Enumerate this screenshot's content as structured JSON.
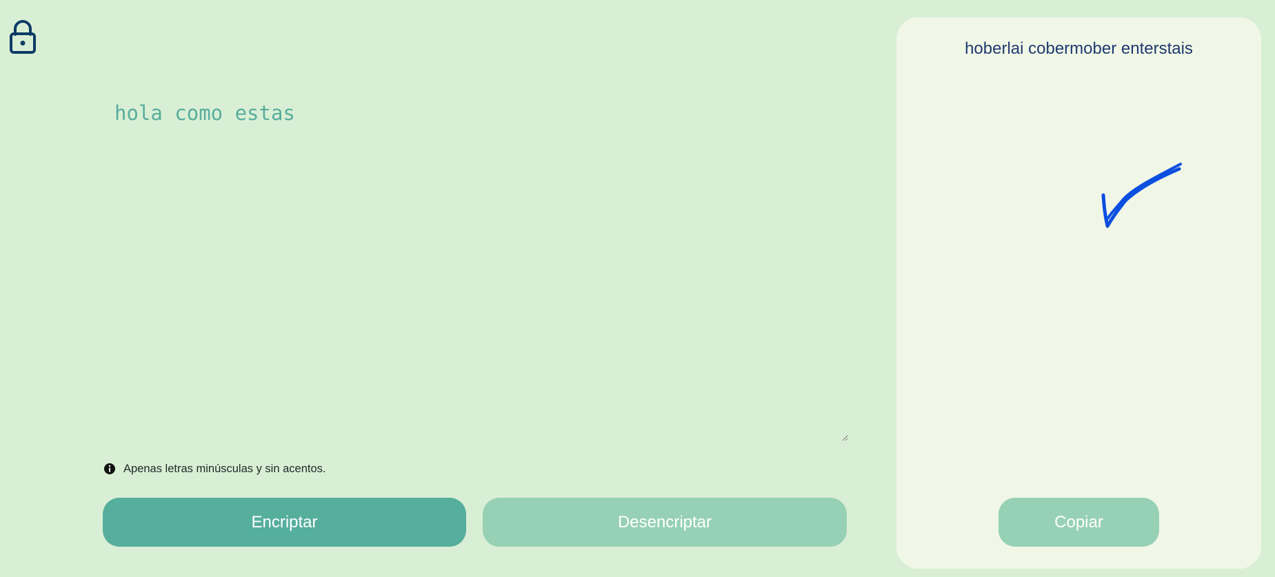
{
  "app": {
    "logo_icon": "lock-icon"
  },
  "input": {
    "value": "hola como estas"
  },
  "hint": {
    "icon": "info-icon",
    "text": "Apenas letras minúsculas y sin acentos."
  },
  "buttons": {
    "encrypt_label": "Encriptar",
    "decrypt_label": "Desencriptar"
  },
  "output": {
    "text": "hoberlai cobermober enterstais",
    "mark_icon": "checkmark-icon",
    "copy_label": "Copiar"
  },
  "colors": {
    "background": "#d9efd5",
    "panel": "#f0f7e7",
    "primary_button": "#56ae9d",
    "secondary_button": "#97d1b5",
    "input_text": "#58ad9c",
    "output_text": "#20396f",
    "checkmark": "#0b4fe0",
    "logo": "#0d3b66"
  }
}
